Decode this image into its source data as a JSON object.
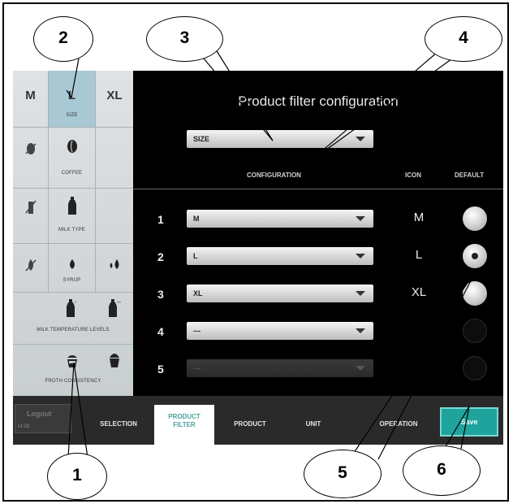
{
  "screen": {
    "title": "Product filter configuration",
    "filter_select": {
      "value": "SIZE"
    },
    "headers": {
      "configuration": "CONFIGURATION",
      "icon": "ICON",
      "default": "DEFAULT"
    },
    "rows": [
      {
        "num": "1",
        "value": "M",
        "icon": "M",
        "default_state": "available"
      },
      {
        "num": "2",
        "value": "L",
        "icon": "L",
        "default_state": "selected"
      },
      {
        "num": "3",
        "value": "XL",
        "icon": "XL",
        "default_state": "available"
      },
      {
        "num": "4",
        "value": "---",
        "icon": "",
        "default_state": "inactive"
      },
      {
        "num": "5",
        "value": "---",
        "icon": "",
        "default_state": "inactive",
        "disabled": true
      }
    ]
  },
  "sidebar": {
    "size": {
      "options": [
        "M",
        "L",
        "XL"
      ],
      "selected": "L",
      "label": "SIZE"
    },
    "coffee": {
      "label": "COFFEE",
      "icon_off": "no-coffee-bean-icon",
      "icon": "coffee-bean-icon"
    },
    "milk_type": {
      "label": "MILK TYPE",
      "icon_off": "no-milk-bottle-icon",
      "icon": "milk-bottle-icon"
    },
    "syrup": {
      "label": "SYRUP",
      "icon_off": "no-syrup-drop-icon",
      "icon": "syrup-drop-icon",
      "icon_alt": "syrup-drops-icon"
    },
    "milk_temp": {
      "label": "MILK TEMPERATURE LEVELS",
      "icon": "milk-temp-icon",
      "icon_alt": "milk-hot-icon"
    },
    "froth": {
      "label": "FROTH CONSISTENCY",
      "icon": "froth-cup-icon",
      "icon_alt": "froth-cup-full-icon"
    }
  },
  "bottom_bar": {
    "logout": "Logout",
    "time": "14:28",
    "tabs": [
      "SELECTION",
      "PRODUCT FILTER",
      "PRODUCT",
      "UNIT",
      "OPERATION"
    ],
    "active_tab": "PRODUCT FILTER",
    "save": "Save"
  },
  "callouts": [
    "1",
    "2",
    "3",
    "4",
    "5",
    "6"
  ],
  "colors": {
    "accent": "#1fa39d",
    "selected_cell": "#a8c9d3",
    "background": "#000000"
  }
}
